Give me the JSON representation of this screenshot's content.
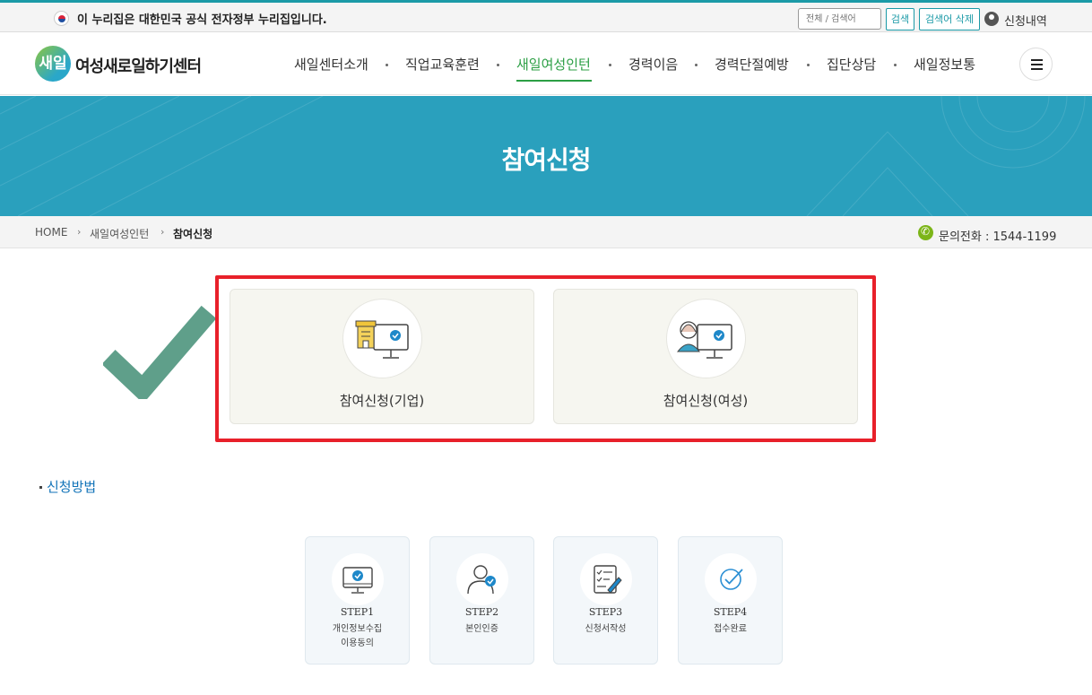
{
  "topbar": {
    "gov_notice": "이 누리집은 대한민국 공식 전자정부 누리집입니다.",
    "search_placeholder": "전체 / 검색어",
    "search_button": "검색",
    "clear_button": "검색어 삭제",
    "apply_history": "신청내역"
  },
  "header": {
    "logo_mark": "새일",
    "logo_text": "여성새로일하기센터",
    "nav": [
      {
        "label": "새일센터소개"
      },
      {
        "label": "직업교육훈련"
      },
      {
        "label": "새일여성인턴"
      },
      {
        "label": "경력이음"
      },
      {
        "label": "경력단절예방"
      },
      {
        "label": "집단상담"
      },
      {
        "label": "새일정보통"
      }
    ],
    "active_nav": "새일여성인턴"
  },
  "banner": {
    "title": "참여신청"
  },
  "breadcrumb": {
    "items": [
      "HOME",
      "새일여성인턴",
      "참여신청"
    ],
    "phone": "문의전화 : 1544-1199"
  },
  "apply": {
    "cards": [
      {
        "label": "참여신청(기업)",
        "icon": "company-computer-icon"
      },
      {
        "label": "참여신청(여성)",
        "icon": "woman-computer-icon"
      }
    ]
  },
  "howto": {
    "title": "신청방법",
    "steps": [
      {
        "num": "STEP1",
        "label": "개인정보수집\n이용동의",
        "icon": "monitor-check-icon"
      },
      {
        "num": "STEP2",
        "label": "본인인증",
        "icon": "person-check-icon"
      },
      {
        "num": "STEP3",
        "label": "신청서작성",
        "icon": "form-write-icon"
      },
      {
        "num": "STEP4",
        "label": "접수완료",
        "icon": "complete-check-icon"
      }
    ]
  },
  "colors": {
    "accent": "#1b9aa7",
    "banner": "#2aa0bd",
    "nav_active": "#2c9f45",
    "highlight": "#e8202a",
    "check_mark": "#5f9f8a"
  }
}
